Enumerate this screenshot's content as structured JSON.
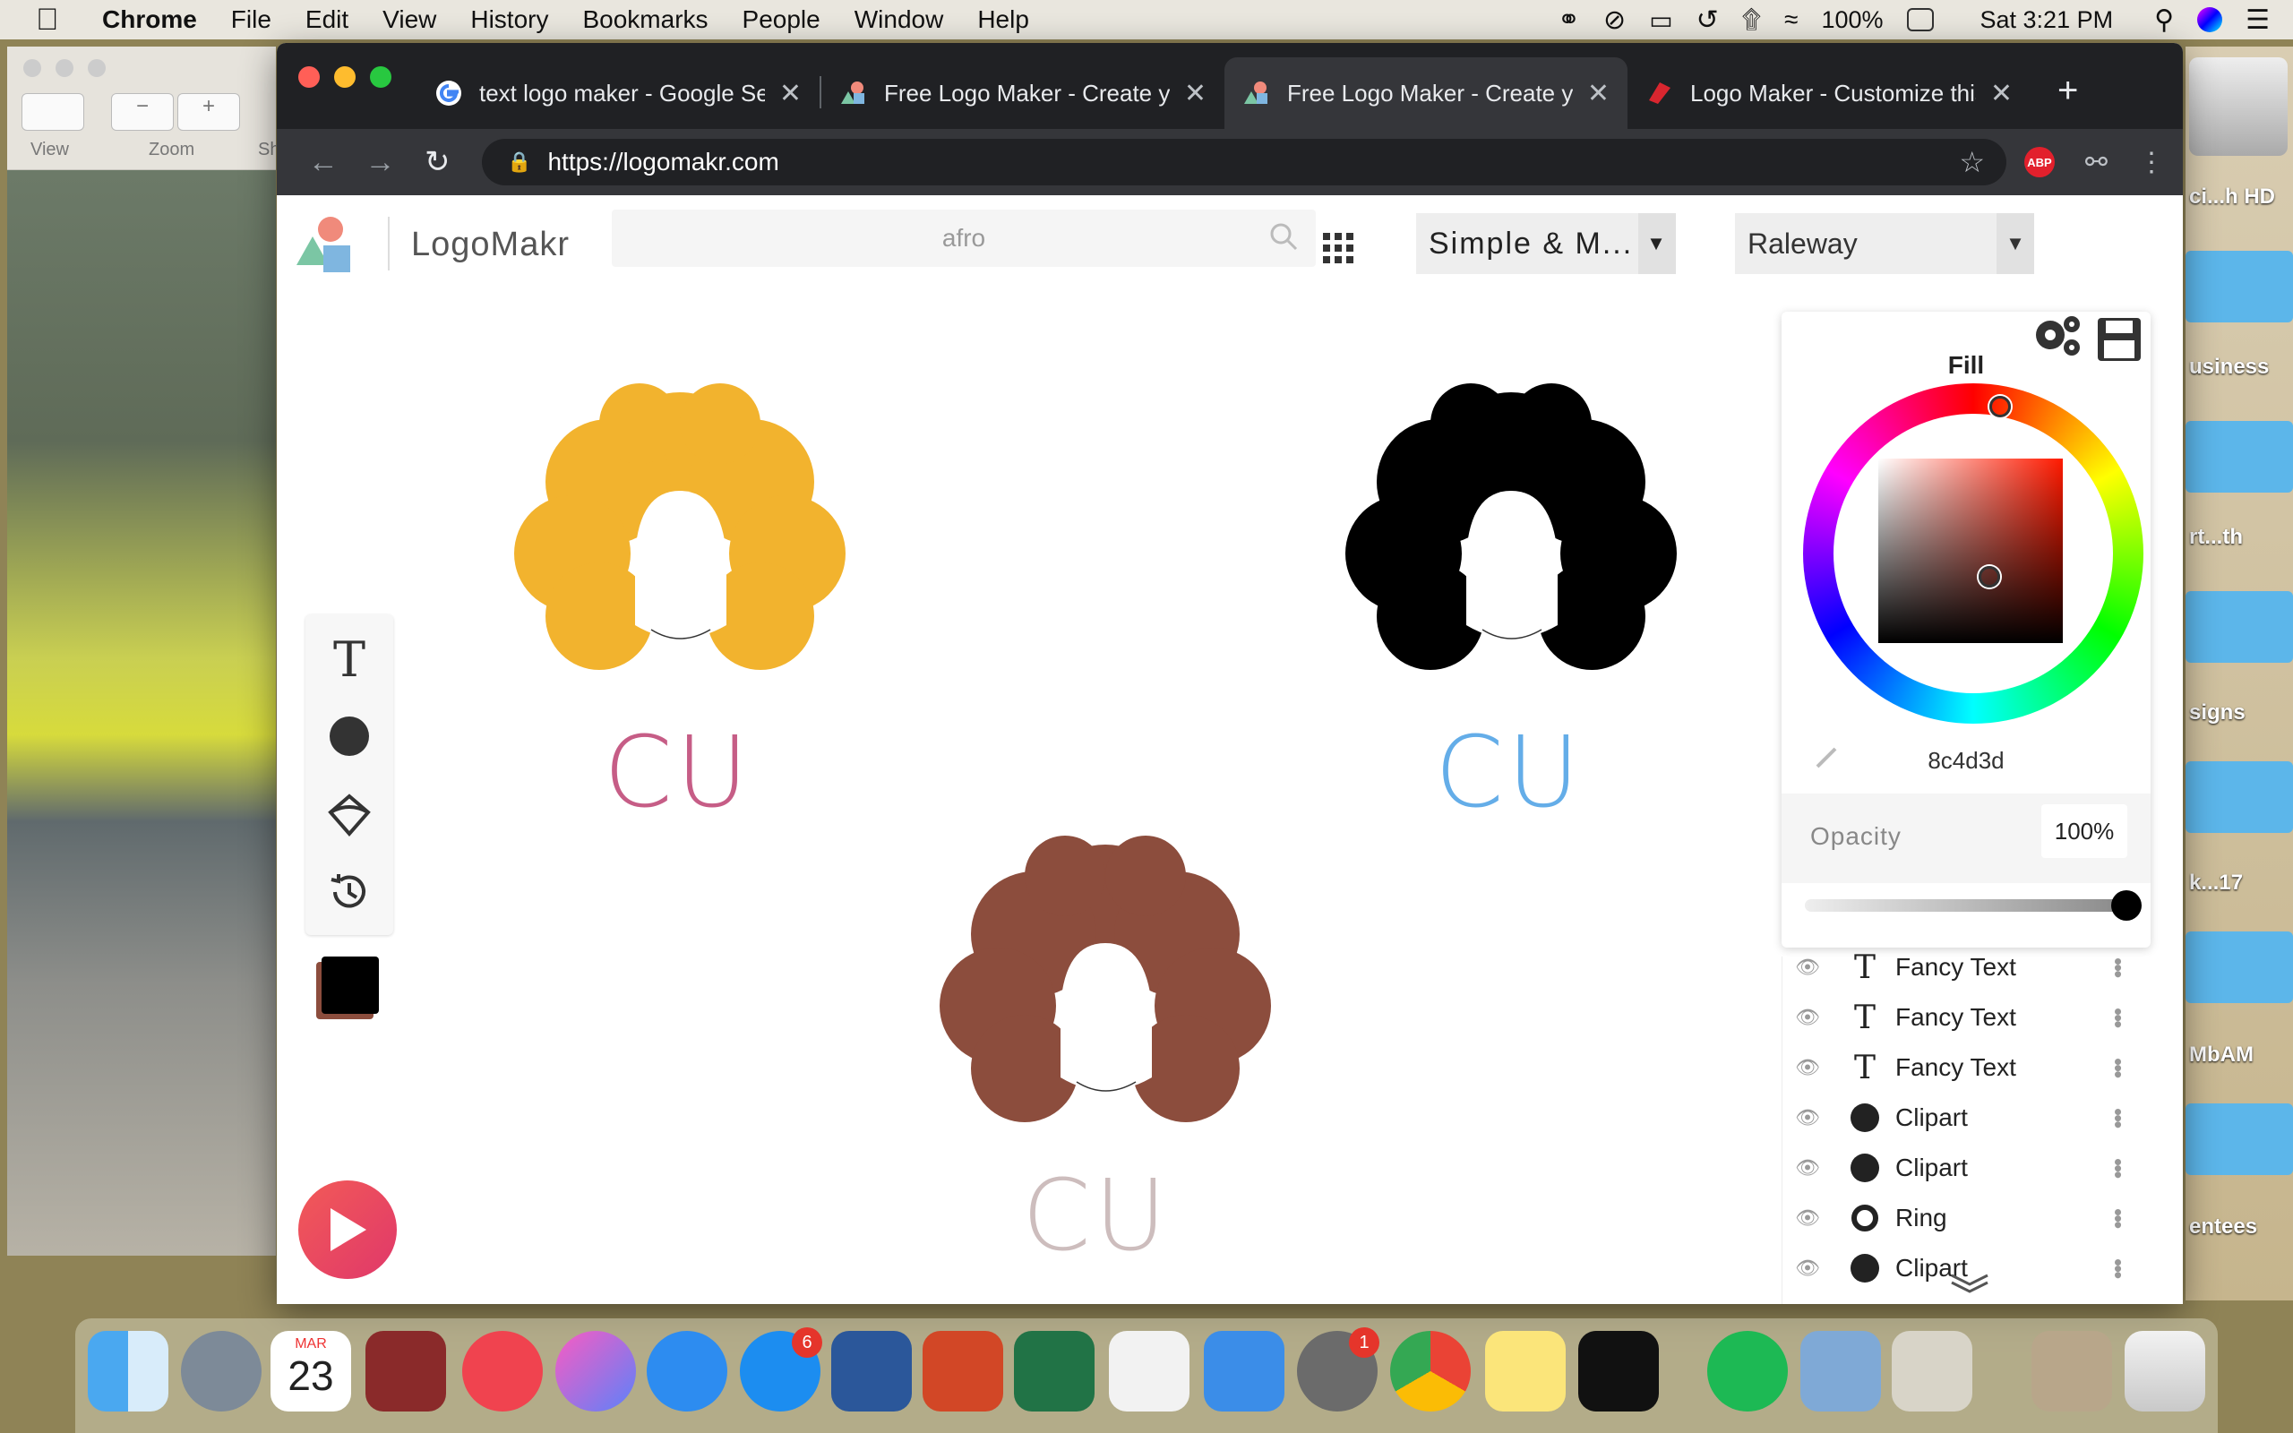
{
  "menubar": {
    "app": "Chrome",
    "items": [
      "File",
      "Edit",
      "View",
      "History",
      "Bookmarks",
      "People",
      "Window",
      "Help"
    ],
    "battery": "100%",
    "clock": "Sat 3:21 PM"
  },
  "preview": {
    "view_label": "View",
    "zoom_label": "Zoom",
    "share_label": "Sh"
  },
  "desktop_labels": [
    "ci...h HD",
    "usiness",
    "rt...th",
    "signs",
    "k...17",
    "MbAM",
    "entees"
  ],
  "browser": {
    "tabs": [
      {
        "title": "text logo maker - Google Se",
        "icon": "google-icon",
        "active": false
      },
      {
        "title": "Free Logo Maker - Create yo",
        "icon": "logomakr-icon",
        "active": false
      },
      {
        "title": "Free Logo Maker - Create yo",
        "icon": "logomakr-icon",
        "active": true
      },
      {
        "title": "Logo Maker - Customize this",
        "icon": "logo-maker-icon",
        "active": false
      }
    ],
    "url": "https://logomakr.com",
    "abp_label": "ABP"
  },
  "logomakr": {
    "brand": "LogoMakr",
    "search_value": "afro",
    "font_style": "Simple & M...",
    "font_name": "Raleway",
    "logos": [
      {
        "text": "CU",
        "hair_color": "#F2B32E",
        "text_color": "#C65D86"
      },
      {
        "text": "CU",
        "hair_color": "#000000",
        "text_color": "#64ADE8"
      },
      {
        "text": "CU",
        "hair_color": "#8C4D3D",
        "text_color": "#CDBDBD"
      }
    ],
    "current_color": "#000000",
    "secondary_color": "#8c4d3d"
  },
  "fill_panel": {
    "title": "Fill",
    "hex": "8c4d3d",
    "opacity_label": "Opacity",
    "opacity_value": "100%",
    "opacity_fraction": 1.0
  },
  "layers": [
    {
      "name": "Fancy Text",
      "icon": "text-icon"
    },
    {
      "name": "Fancy Text",
      "icon": "text-icon"
    },
    {
      "name": "Fancy Text",
      "icon": "text-icon"
    },
    {
      "name": "Clipart",
      "icon": "clipart-icon"
    },
    {
      "name": "Clipart",
      "icon": "clipart-icon"
    },
    {
      "name": "Ring",
      "icon": "ring-icon"
    },
    {
      "name": "Clipart",
      "icon": "clipart-icon"
    }
  ],
  "dock": {
    "calendar_month": "MAR",
    "calendar_day": "23",
    "appstore_badge": "6",
    "prefs_badge": "1"
  }
}
